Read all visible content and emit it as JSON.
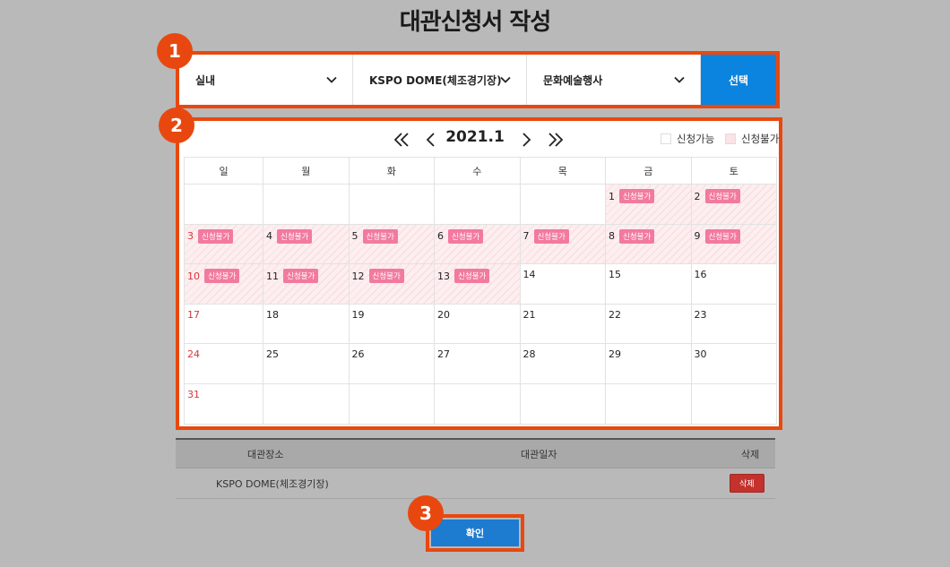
{
  "page": {
    "title": "대관신청서 작성"
  },
  "steps": [
    "1",
    "2",
    "3"
  ],
  "selectors": {
    "category": "실내",
    "venue": "KSPO DOME(체조경기장)",
    "event_type": "문화예술행사",
    "select_label": "선택"
  },
  "calendar": {
    "month_label": "2021.1",
    "legend_available": "신청가능",
    "legend_unavailable": "신청불가",
    "weekdays": [
      "일",
      "월",
      "화",
      "수",
      "목",
      "금",
      "토"
    ],
    "blocked_tag": "신청불가",
    "weeks": [
      [
        null,
        null,
        null,
        null,
        null,
        1,
        2
      ],
      [
        3,
        4,
        5,
        6,
        7,
        8,
        9
      ],
      [
        10,
        11,
        12,
        13,
        14,
        15,
        16
      ],
      [
        17,
        18,
        19,
        20,
        21,
        22,
        23
      ],
      [
        24,
        25,
        26,
        27,
        28,
        29,
        30
      ],
      [
        31,
        null,
        null,
        null,
        null,
        null,
        null
      ]
    ],
    "blocked_days": [
      1,
      2,
      3,
      4,
      5,
      6,
      7,
      8,
      9,
      10,
      11,
      12,
      13
    ]
  },
  "list": {
    "headers": {
      "venue": "대관장소",
      "date": "대관일자",
      "delete": "삭제"
    },
    "rows": [
      {
        "venue": "KSPO DOME(체조경기장)",
        "date": "",
        "delete_label": "삭제"
      }
    ]
  },
  "confirm_label": "확인",
  "colors": {
    "accent": "#e8480f",
    "primary_button": "#0a84de",
    "blocked_tag": "#f27a9e",
    "delete": "#c3322c"
  }
}
